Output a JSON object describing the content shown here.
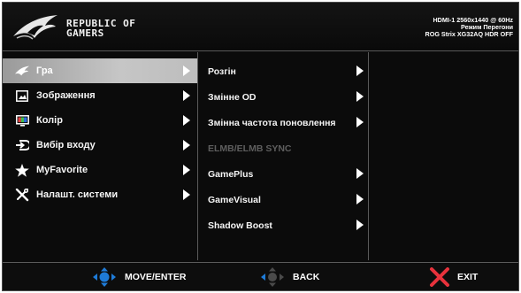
{
  "header": {
    "logo_text_line1": "REPUBLIC OF",
    "logo_text_line2": "GAMERS",
    "status_lines": [
      "HDMI-1 2560x1440 @ 60Hz",
      "Режим Перегони",
      "ROG Strix XG32AQ HDR OFF"
    ]
  },
  "menu": {
    "items": [
      {
        "label": "Гра",
        "icon": "rog-eye-icon"
      },
      {
        "label": "Зображення",
        "icon": "picture-icon"
      },
      {
        "label": "Колір",
        "icon": "color-icon"
      },
      {
        "label": "Вибір входу",
        "icon": "input-icon"
      },
      {
        "label": "MyFavorite",
        "icon": "star-icon"
      },
      {
        "label": "Налашт. системи",
        "icon": "tools-icon"
      }
    ],
    "active_index": 0
  },
  "submenu": {
    "items": [
      {
        "label": "Розгін",
        "enabled": true
      },
      {
        "label": "Змінне OD",
        "enabled": true
      },
      {
        "label": "Змінна частота поновлення",
        "enabled": true
      },
      {
        "label": "ELMB/ELMB SYNC",
        "enabled": false
      },
      {
        "label": "GamePlus",
        "enabled": true
      },
      {
        "label": "GameVisual",
        "enabled": true
      },
      {
        "label": "Shadow Boost",
        "enabled": true
      }
    ]
  },
  "footer": {
    "move_label": "MOVE/ENTER",
    "back_label": "BACK",
    "exit_label": "EXIT"
  },
  "colors": {
    "accent_blue": "#1e7bd8",
    "exit_red": "#e8323c",
    "active_bg": "#b3b3b3",
    "disabled_text": "#5e5e5e"
  }
}
